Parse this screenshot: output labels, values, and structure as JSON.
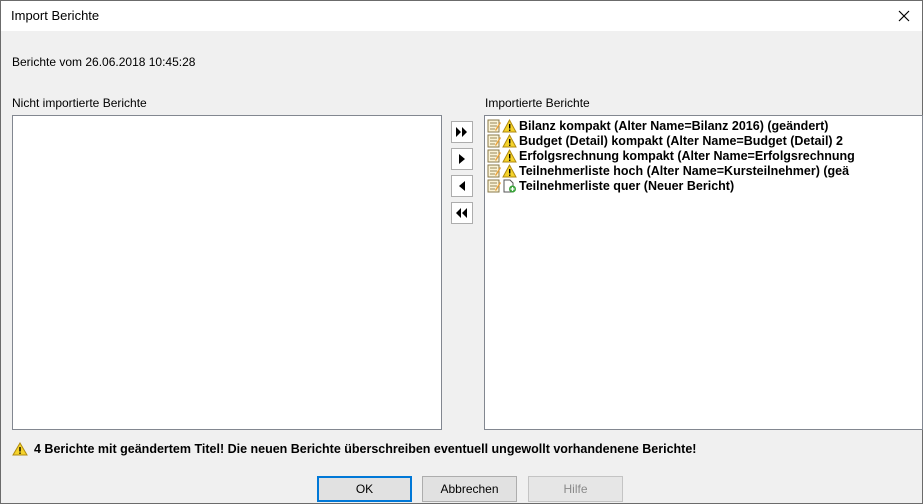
{
  "window": {
    "title": "Import Berichte",
    "close_icon": "close-icon"
  },
  "subtitle": "Berichte vom 26.06.2018 10:45:28",
  "left_list": {
    "label": "Nicht importierte Berichte",
    "items": []
  },
  "right_list": {
    "label": "Importierte Berichte",
    "items": [
      {
        "text": "Bilanz kompakt (Alter Name=Bilanz 2016) (geändert)",
        "status_icon": "warning-icon"
      },
      {
        "text": "Budget (Detail) kompakt (Alter Name=Budget (Detail) 2",
        "status_icon": "warning-icon"
      },
      {
        "text": "Erfolgsrechnung kompakt (Alter Name=Erfolgsrechnung",
        "status_icon": "warning-icon"
      },
      {
        "text": "Teilnehmerliste hoch (Alter Name=Kursteilnehmer) (geä",
        "status_icon": "warning-icon"
      },
      {
        "text": "Teilnehmerliste quer (Neuer Bericht)",
        "status_icon": "new-document-icon"
      }
    ]
  },
  "move_buttons": [
    "move-all-right-icon",
    "move-right-icon",
    "move-left-icon",
    "move-all-left-icon"
  ],
  "warning_message": "4 Berichte mit geändertem Titel!  Die neuen Berichte überschreiben eventuell ungewollt vorhandenene Berichte!",
  "buttons": {
    "ok": "OK",
    "cancel": "Abbrechen",
    "help": "Hilfe"
  },
  "colors": {
    "focus_border": "#0078d7",
    "warning_yellow": "#f5d32a"
  }
}
